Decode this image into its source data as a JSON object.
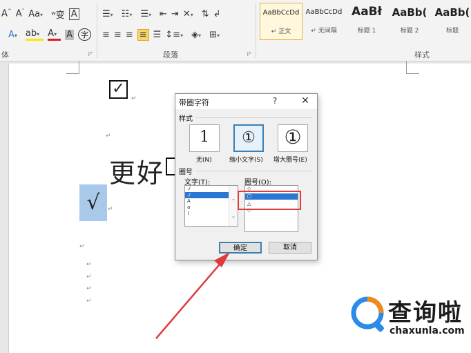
{
  "ribbon": {
    "font_group_label": "体",
    "paragraph_group_label": "段落",
    "styles_group_label": "样式",
    "font_row1": [
      "A˄",
      "A˅",
      "Aa",
      "ʷ变",
      "A"
    ],
    "styles": [
      {
        "sample": "AaBbCcDd",
        "name": "↵ 正文"
      },
      {
        "sample": "AaBbCcDd",
        "name": "↵ 无间隔"
      },
      {
        "sample": "AaBł",
        "name": "标题 1"
      },
      {
        "sample": "AaBb(",
        "name": "标题 2"
      },
      {
        "sample": "AaBb(",
        "name": "标题"
      }
    ]
  },
  "document": {
    "checkbox_char": "✓",
    "big_text": "更好",
    "selected_char": "√",
    "para_mark": "↵"
  },
  "dialog": {
    "title": "带圈字符",
    "help": "?",
    "close": "✕",
    "style_section": "样式",
    "styles": [
      {
        "symbol": "1",
        "caption": "无(N)"
      },
      {
        "symbol": "①",
        "caption": "缩小文字(S)"
      },
      {
        "symbol": "①",
        "caption": "增大圈号(E)"
      }
    ],
    "enclosure_section": "圈号",
    "text_label": "文字(T):",
    "enclosure_label": "圈号(O):",
    "text_items": [
      "./",
      "./",
      "A",
      "a",
      "!"
    ],
    "enclosure_items": [
      "◇",
      "□",
      "△",
      "◇"
    ],
    "ok": "确定",
    "cancel": "取消"
  },
  "watermark": {
    "text": "查询啦",
    "url": "chaxunla.com"
  }
}
